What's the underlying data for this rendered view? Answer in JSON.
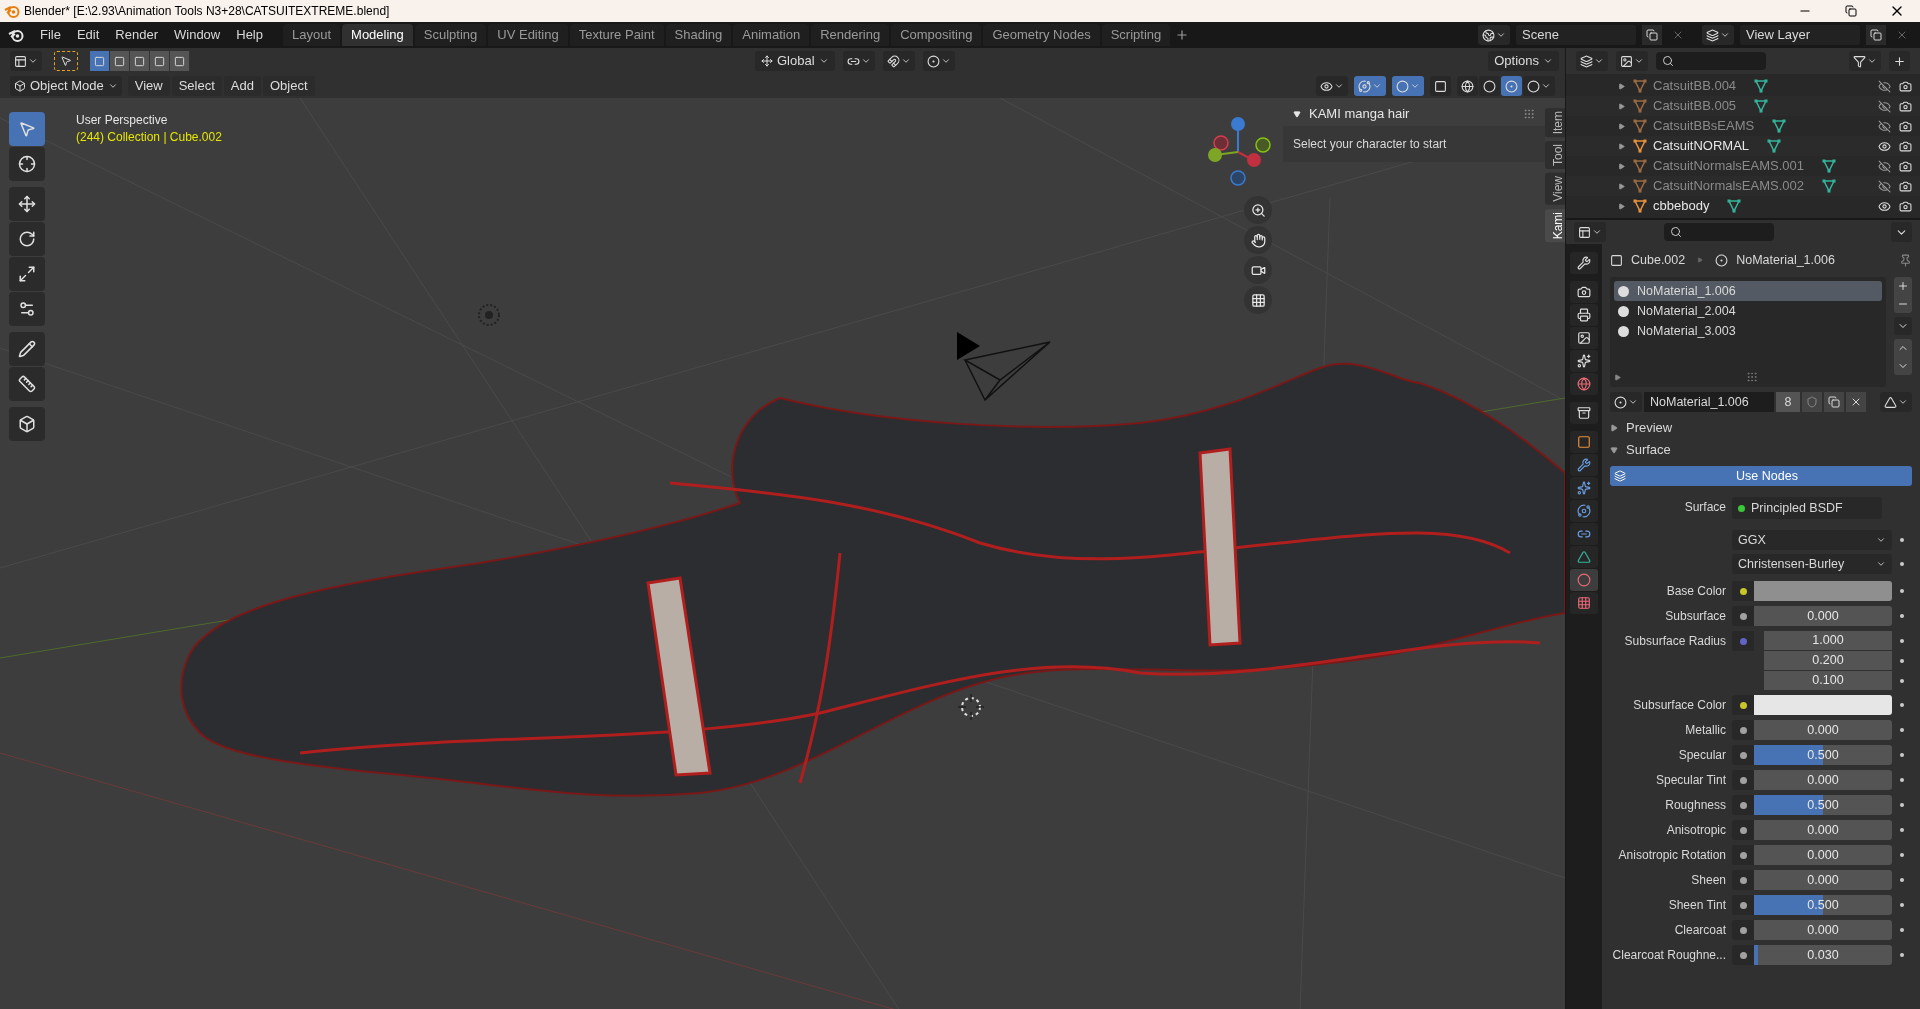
{
  "window": {
    "title": "Blender* [E:\\2.93\\Animation Tools N3+28\\CATSUITEXTREME.blend]"
  },
  "menu": [
    "File",
    "Edit",
    "Render",
    "Window",
    "Help"
  ],
  "workspaces": [
    {
      "label": "Layout",
      "selected": false
    },
    {
      "label": "Modeling",
      "selected": true
    },
    {
      "label": "Sculpting",
      "selected": false
    },
    {
      "label": "UV Editing",
      "selected": false
    },
    {
      "label": "Texture Paint",
      "selected": false
    },
    {
      "label": "Shading",
      "selected": false
    },
    {
      "label": "Animation",
      "selected": false
    },
    {
      "label": "Rendering",
      "selected": false
    },
    {
      "label": "Compositing",
      "selected": false
    },
    {
      "label": "Geometry Nodes",
      "selected": false
    },
    {
      "label": "Scripting",
      "selected": false
    }
  ],
  "scene": {
    "name": "Scene"
  },
  "view_layer": {
    "name": "View Layer"
  },
  "tool_header": {
    "orientation": "Global",
    "options": "Options"
  },
  "viewport_header": {
    "mode": "Object Mode",
    "menus": [
      "View",
      "Select",
      "Add",
      "Object"
    ]
  },
  "viewport": {
    "view_name": "User Perspective",
    "context": "(244) Collection | Cube.002"
  },
  "tools": [
    {
      "kind": "select",
      "selected": true
    },
    {
      "kind": "cursor",
      "selected": false
    },
    {
      "kind": "move",
      "selected": false
    },
    {
      "kind": "rotate",
      "selected": false
    },
    {
      "kind": "scale",
      "selected": false
    },
    {
      "kind": "transform",
      "selected": false
    },
    {
      "kind": "annotate",
      "selected": false
    },
    {
      "kind": "measure",
      "selected": false
    },
    {
      "kind": "add_cube",
      "selected": false
    }
  ],
  "sidebar": {
    "panel": {
      "title": "KAMI manga hair",
      "text": "Select your character to start"
    },
    "tabs": [
      {
        "label": "Item",
        "selected": false
      },
      {
        "label": "Tool",
        "selected": false
      },
      {
        "label": "View",
        "selected": false
      },
      {
        "label": "Kami",
        "selected": true
      }
    ]
  },
  "outliner": {
    "items": [
      {
        "name": "CatsuitBB.004",
        "visible": false
      },
      {
        "name": "CatsuitBB.005",
        "visible": false
      },
      {
        "name": "CatsuitBBsEAMS",
        "visible": false
      },
      {
        "name": "CatsuitNORMAL",
        "visible": true
      },
      {
        "name": "CatsuitNormalsEAMS.001",
        "visible": false
      },
      {
        "name": "CatsuitNormalsEAMS.002",
        "visible": false
      },
      {
        "name": "cbbebody",
        "visible": true
      }
    ]
  },
  "property_tabs": [
    {
      "kind": "tool",
      "selected": false
    },
    {
      "kind": "render",
      "selected": false
    },
    {
      "kind": "output",
      "selected": false
    },
    {
      "kind": "view_layer",
      "selected": false
    },
    {
      "kind": "scene",
      "selected": false
    },
    {
      "kind": "world",
      "selected": false
    },
    {
      "kind": "collection",
      "selected": false
    },
    {
      "kind": "object",
      "selected": false
    },
    {
      "kind": "modifiers",
      "selected": false
    },
    {
      "kind": "particles",
      "selected": false
    },
    {
      "kind": "physics",
      "selected": false
    },
    {
      "kind": "constraints",
      "selected": false
    },
    {
      "kind": "data",
      "selected": false
    },
    {
      "kind": "material",
      "selected": true
    },
    {
      "kind": "texture",
      "selected": false
    }
  ],
  "properties": {
    "breadcrumb": {
      "object": "Cube.002",
      "material": "NoMaterial_1.006"
    },
    "slots": [
      {
        "name": "NoMaterial_1.006",
        "selected": true
      },
      {
        "name": "NoMaterial_2.004",
        "selected": false
      },
      {
        "name": "NoMaterial_3.003",
        "selected": false
      }
    ],
    "material_name": "NoMaterial_1.006",
    "users": "8",
    "panels": [
      {
        "title": "Preview",
        "expanded": false
      },
      {
        "title": "Surface",
        "expanded": true
      }
    ],
    "use_nodes": "Use Nodes",
    "surface": {
      "label": "Surface",
      "value": "Principled BSDF"
    },
    "dropdowns": [
      "GGX",
      "Christensen-Burley"
    ],
    "inputs": [
      {
        "label": "Base Color",
        "kind": "color",
        "color": "#8f8f8f"
      },
      {
        "label": "Subsurface",
        "kind": "value",
        "value": "0.000",
        "level": 0
      },
      {
        "label": "Subsurface Radius",
        "kind": "vector",
        "values": [
          "1.000",
          "0.200",
          "0.100"
        ]
      },
      {
        "label": "Subsurface Color",
        "kind": "color",
        "color": "#e6e6e6"
      },
      {
        "label": "Metallic",
        "kind": "value",
        "value": "0.000",
        "level": 0
      },
      {
        "label": "Specular",
        "kind": "value",
        "value": "0.500",
        "level": 0.5
      },
      {
        "label": "Specular Tint",
        "kind": "value",
        "value": "0.000",
        "level": 0
      },
      {
        "label": "Roughness",
        "kind": "value",
        "value": "0.500",
        "level": 0.5
      },
      {
        "label": "Anisotropic",
        "kind": "value",
        "value": "0.000",
        "level": 0
      },
      {
        "label": "Anisotropic Rotation",
        "kind": "value",
        "value": "0.000",
        "level": 0
      },
      {
        "label": "Sheen",
        "kind": "value",
        "value": "0.000",
        "level": 0
      },
      {
        "label": "Sheen Tint",
        "kind": "value",
        "value": "0.500",
        "level": 0.5
      },
      {
        "label": "Clearcoat",
        "kind": "value",
        "value": "0.000",
        "level": 0
      },
      {
        "label": "Clearcoat Roughne...",
        "kind": "value",
        "value": "0.030",
        "level": 0.03
      }
    ]
  }
}
